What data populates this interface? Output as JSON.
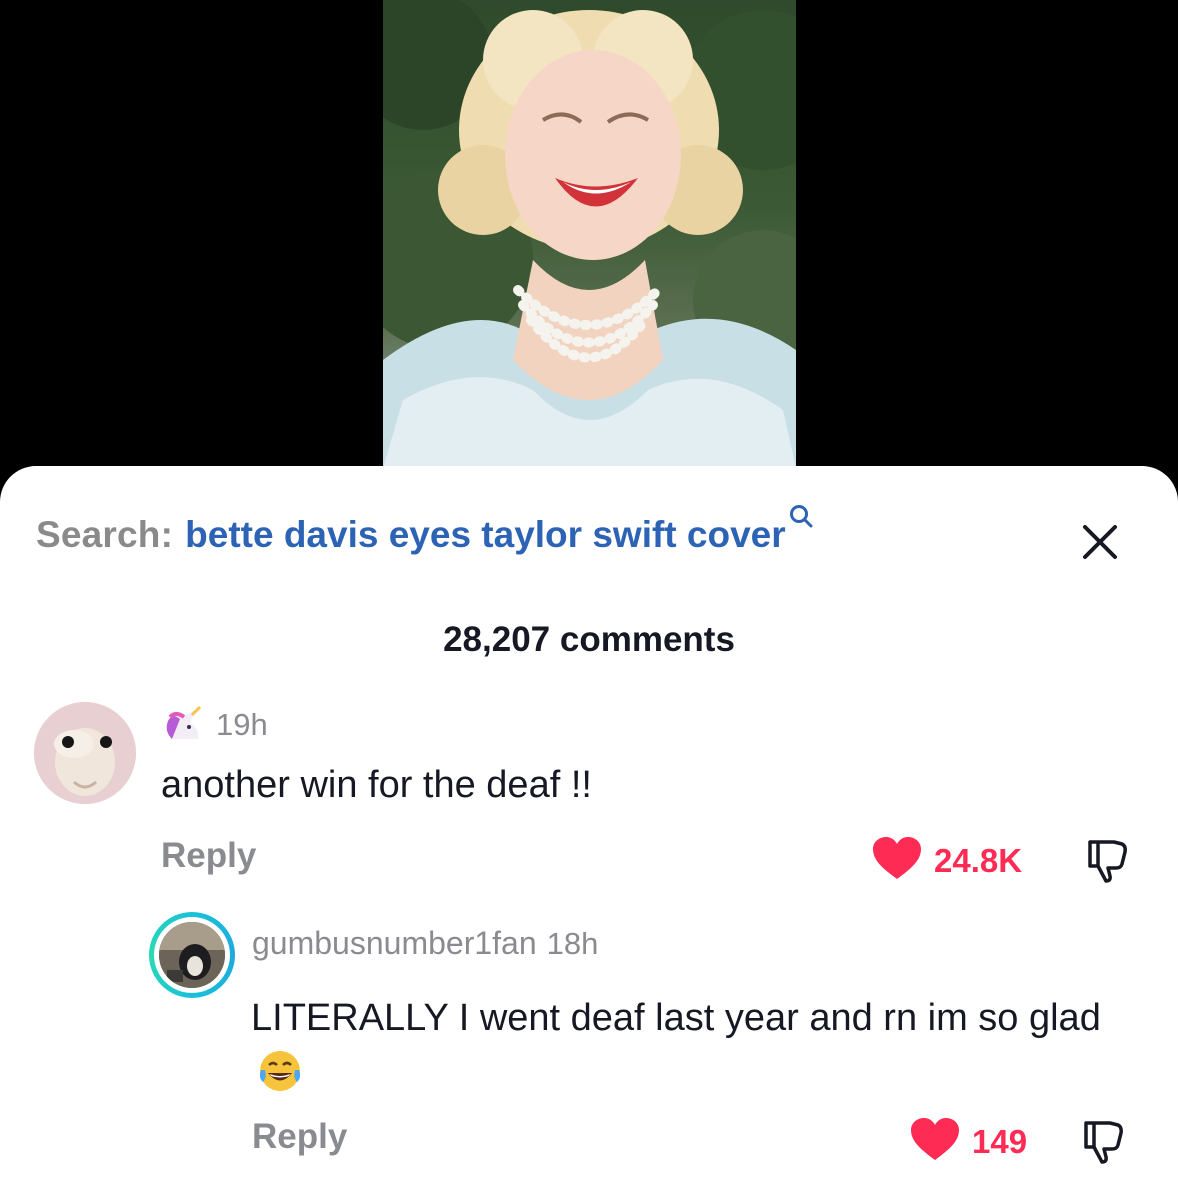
{
  "video": {
    "thumbnail_icon": "video-thumbnail-woman-singing"
  },
  "search": {
    "label": "Search:",
    "query": "bette davis eyes taylor swift cover",
    "icon": "search-icon",
    "query_color": "#2d63b5"
  },
  "close": {
    "icon": "close-icon"
  },
  "comments": {
    "count_label": "28,207 comments",
    "items": [
      {
        "username_icon": "unicorn-emoji",
        "time": "19h",
        "text": "another win for the deaf !!",
        "reply_label": "Reply",
        "likes": "24.8K",
        "like_icon": "heart-icon",
        "dislike_icon": "thumbs-down-icon"
      }
    ],
    "replies": [
      {
        "username": "gumbusnumber1fan",
        "time": "18h",
        "text": "LITERALLY I went deaf last year and rn im so glad",
        "emoji": "laughing-tears-emoji",
        "reply_label": "Reply",
        "likes": "149",
        "like_icon": "heart-icon",
        "dislike_icon": "thumbs-down-icon"
      }
    ]
  },
  "colors": {
    "like": "#fe2c55",
    "muted": "#8a8b91",
    "text": "#161823",
    "story_ring": "#19c2d8"
  }
}
